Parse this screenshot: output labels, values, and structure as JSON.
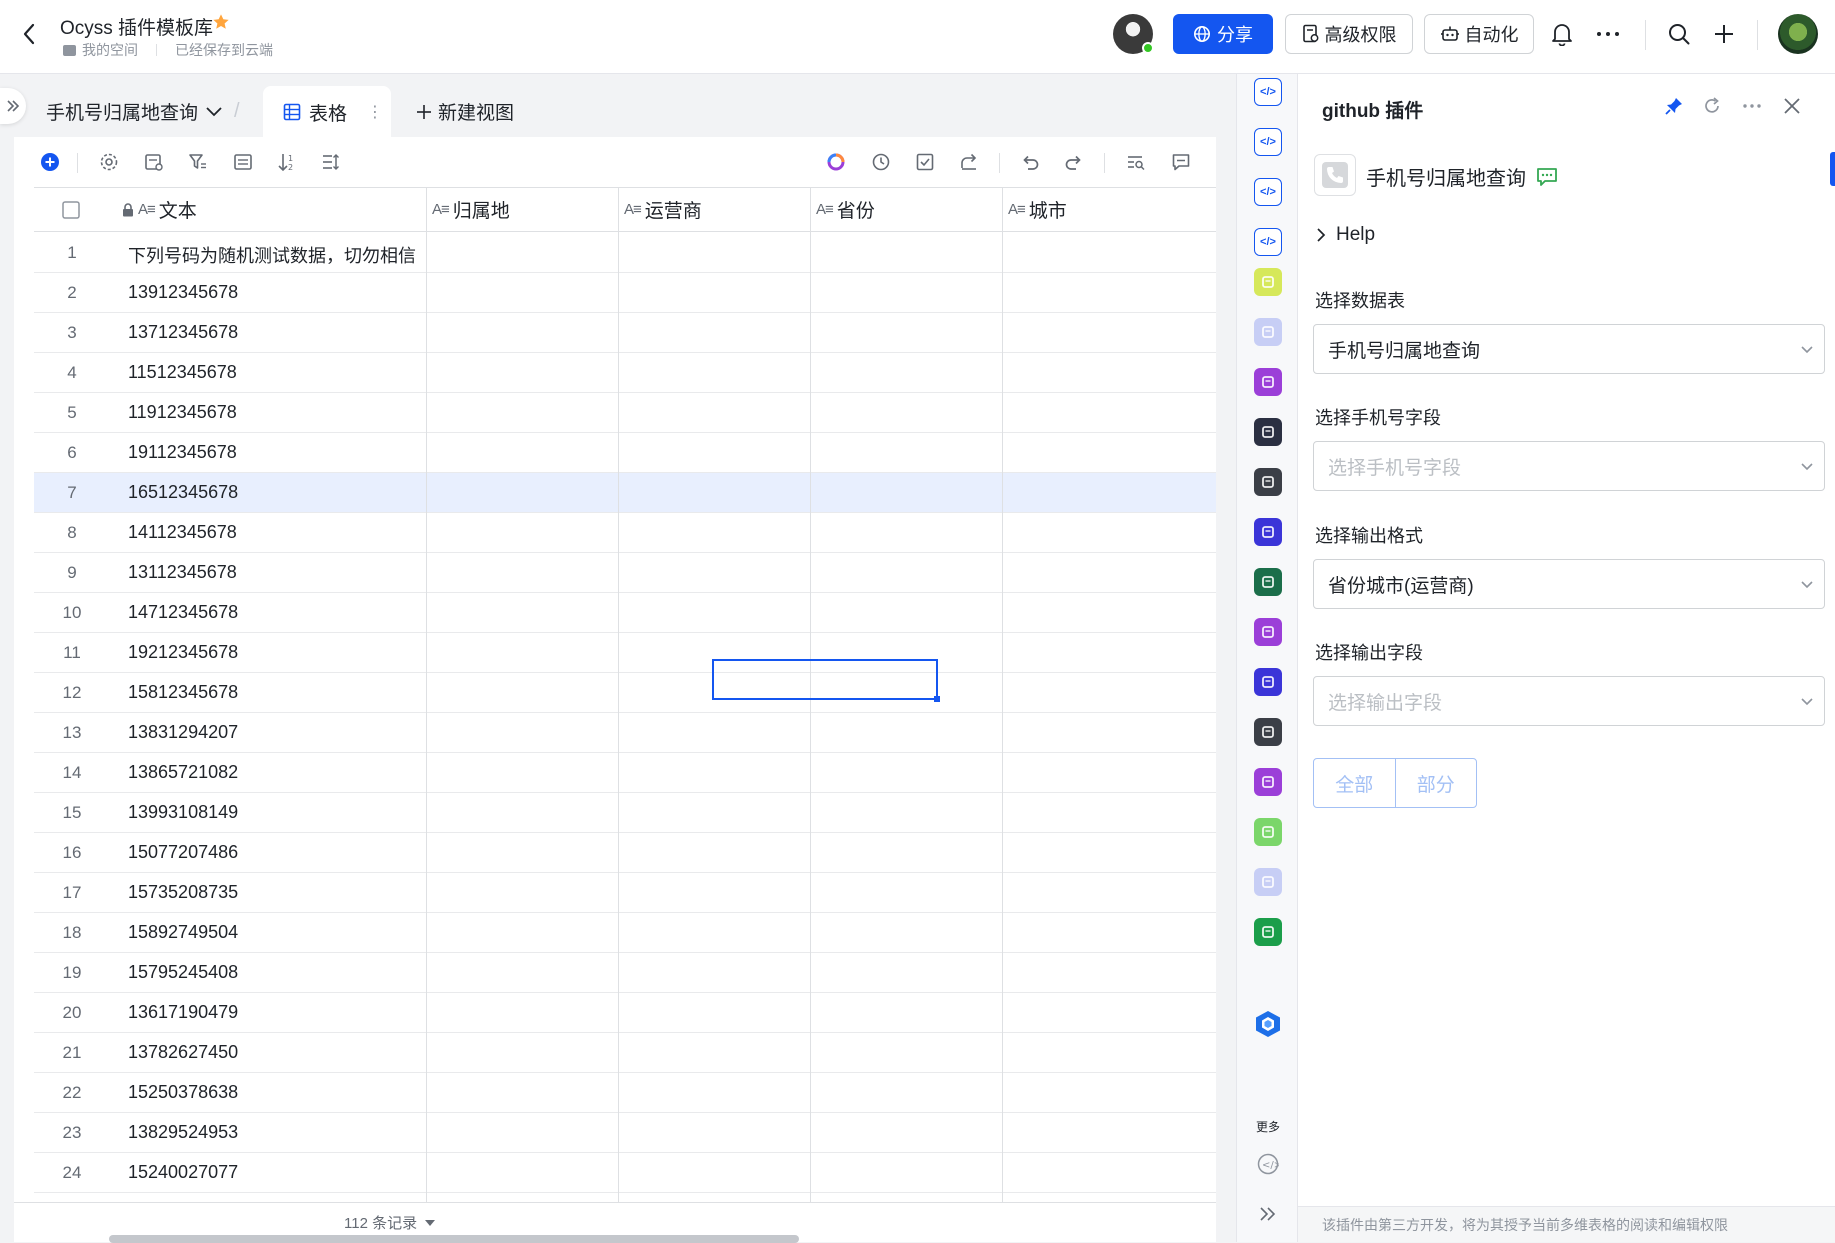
{
  "header": {
    "doc_title": "Ocyss 插件模板库",
    "breadcrumb_space": "我的空间",
    "save_status": "已经保存到云端",
    "share_label": "分享",
    "permission_label": "高级权限",
    "automation_label": "自动化"
  },
  "views": {
    "table_name": "手机号归属地查询",
    "active_view_label": "表格",
    "new_view_label": "新建视图"
  },
  "grid": {
    "columns": [
      "文本",
      "归属地",
      "运营商",
      "省份",
      "城市"
    ],
    "rows": [
      {
        "num": "1",
        "text": "下列号码为随机测试数据，切勿相信"
      },
      {
        "num": "2",
        "text": "13912345678"
      },
      {
        "num": "3",
        "text": "13712345678"
      },
      {
        "num": "4",
        "text": "11512345678"
      },
      {
        "num": "5",
        "text": "11912345678"
      },
      {
        "num": "6",
        "text": "19112345678"
      },
      {
        "num": "7",
        "text": "16512345678"
      },
      {
        "num": "8",
        "text": "14112345678"
      },
      {
        "num": "9",
        "text": "13112345678"
      },
      {
        "num": "10",
        "text": "14712345678"
      },
      {
        "num": "11",
        "text": "19212345678"
      },
      {
        "num": "12",
        "text": "15812345678"
      },
      {
        "num": "13",
        "text": "13831294207"
      },
      {
        "num": "14",
        "text": "13865721082"
      },
      {
        "num": "15",
        "text": "13993108149"
      },
      {
        "num": "16",
        "text": "15077207486"
      },
      {
        "num": "17",
        "text": "15735208735"
      },
      {
        "num": "18",
        "text": "15892749504"
      },
      {
        "num": "19",
        "text": "15795245408"
      },
      {
        "num": "20",
        "text": "13617190479"
      },
      {
        "num": "21",
        "text": "13782627450"
      },
      {
        "num": "22",
        "text": "15250378638"
      },
      {
        "num": "23",
        "text": "13829524953"
      },
      {
        "num": "24",
        "text": "15240027077"
      }
    ],
    "selected_row": 7,
    "record_count": "112 条记录"
  },
  "rail": {
    "more_label": "更多",
    "apps": [
      {
        "name": "notes-app-icon",
        "color": "#d6e85a"
      },
      {
        "name": "image-app-icon",
        "color": "#c7cef5"
      },
      {
        "name": "purple-app-icon",
        "color": "#9b3fd8"
      },
      {
        "name": "globe-app-icon",
        "color": "#2b3042"
      },
      {
        "name": "calc-app-icon",
        "color": "#3b3f47"
      },
      {
        "name": "search-app-icon",
        "color": "#3b35d8"
      },
      {
        "name": "green-app-icon",
        "color": "#1b6e4a"
      },
      {
        "name": "form-app-icon",
        "color": "#9b3fd8"
      },
      {
        "name": "qr-app-icon",
        "color": "#3b35d8"
      },
      {
        "name": "terminal-app-icon",
        "color": "#3b3f47"
      },
      {
        "name": "list-search-app-icon",
        "color": "#9b3fd8"
      },
      {
        "name": "doc-search-app-icon",
        "color": "#7bd66a"
      },
      {
        "name": "layout-app-icon",
        "color": "#c7cef5"
      },
      {
        "name": "sheet-app-icon",
        "color": "#1b9e4a"
      }
    ]
  },
  "panel": {
    "title": "github 插件",
    "plugin_name": "手机号归属地查询",
    "help_label": "Help",
    "fields": [
      {
        "label": "选择数据表",
        "value": "手机号归属地查询",
        "placeholder": false
      },
      {
        "label": "选择手机号字段",
        "value": "选择手机号字段",
        "placeholder": true
      },
      {
        "label": "选择输出格式",
        "value": "省份城市(运营商)",
        "placeholder": false
      },
      {
        "label": "选择输出字段",
        "value": "选择输出字段",
        "placeholder": true
      }
    ],
    "btn_all": "全部",
    "btn_part": "部分",
    "footer_note": "该插件由第三方开发，将为其授予当前多维表格的阅读和编辑权限"
  },
  "colors": {
    "accent": "#1456f0",
    "selected_row_bg": "#e8effe"
  }
}
